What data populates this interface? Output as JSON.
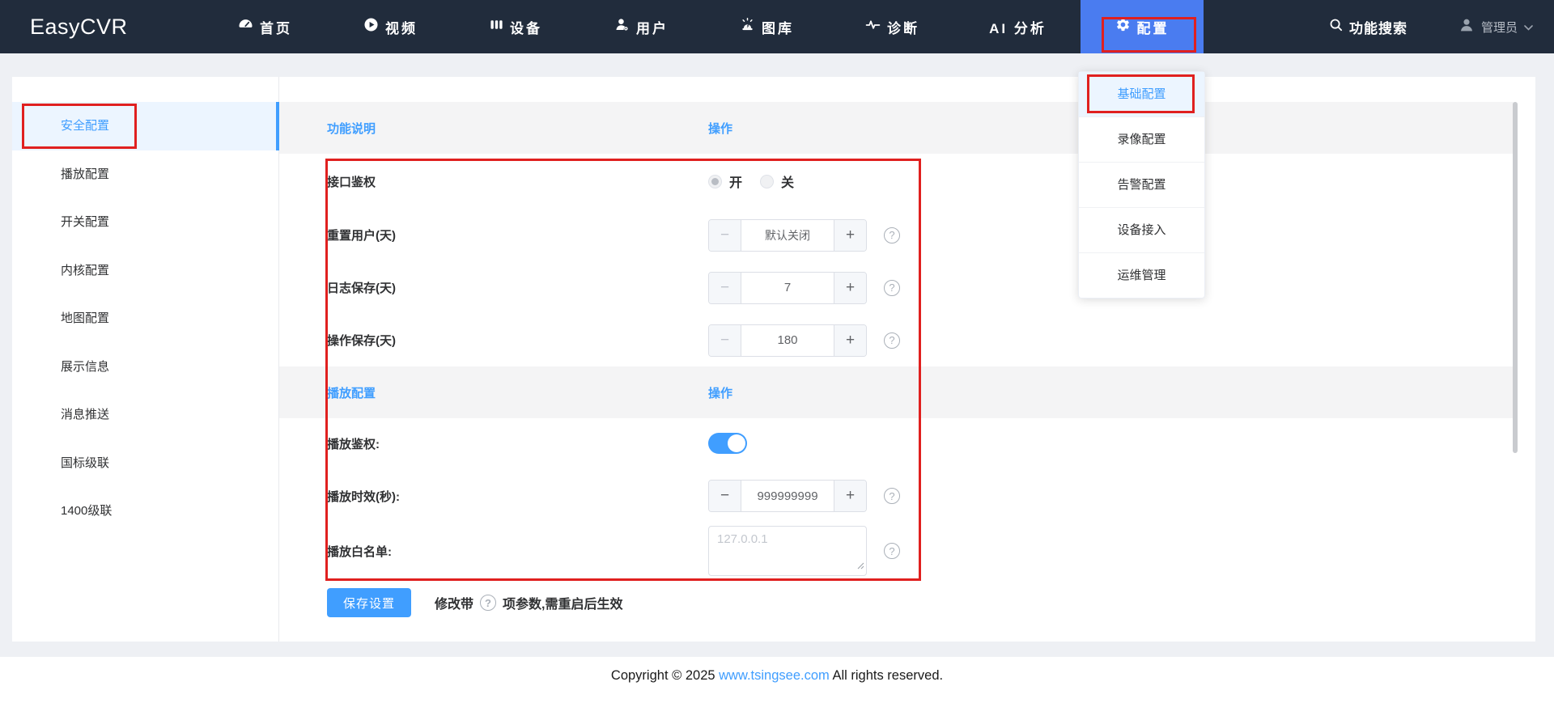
{
  "navbar": {
    "brand": "EasyCVR",
    "items": [
      {
        "label": "首页",
        "icon": "dashboard-icon"
      },
      {
        "label": "视频",
        "icon": "video-icon"
      },
      {
        "label": "设备",
        "icon": "device-icon"
      },
      {
        "label": "用户",
        "icon": "user-icon"
      },
      {
        "label": "图库",
        "icon": "gallery-icon"
      },
      {
        "label": "诊断",
        "icon": "diagnosis-icon"
      },
      {
        "label": "AI 分析",
        "icon": "none"
      },
      {
        "label": "配置",
        "icon": "gear-icon"
      }
    ],
    "search_label": "功能搜索",
    "user_label": "管理员"
  },
  "config_dropdown": {
    "items": [
      "基础配置",
      "录像配置",
      "告警配置",
      "设备接入",
      "运维管理"
    ],
    "active_item": "基础配置"
  },
  "sidebar": {
    "items": [
      "安全配置",
      "播放配置",
      "开关配置",
      "内核配置",
      "地图配置",
      "展示信息",
      "消息推送",
      "国标级联",
      "1400级联"
    ],
    "active_item": "安全配置"
  },
  "main": {
    "section1_header": {
      "left": "功能说明",
      "right": "操作"
    },
    "rows1": [
      {
        "label": "接口鉴权",
        "type": "radio",
        "options": [
          "开",
          "关"
        ],
        "selected": "开"
      },
      {
        "label": "重置用户(天)",
        "type": "stepper",
        "value": "默认关闭"
      },
      {
        "label": "日志保存(天)",
        "type": "stepper",
        "value": "7"
      },
      {
        "label": "操作保存(天)",
        "type": "stepper",
        "value": "180"
      }
    ],
    "section2_header": {
      "left": "播放配置",
      "right": "操作"
    },
    "rows2": [
      {
        "label": "播放鉴权:",
        "type": "switch",
        "state": "on"
      },
      {
        "label": "播放时效(秒):",
        "type": "stepper",
        "value": "999999999"
      },
      {
        "label": "播放白名单:",
        "type": "textarea",
        "placeholder": "127.0.0.1"
      }
    ],
    "save": {
      "button": "保存设置",
      "note_prefix": "修改带",
      "note_suffix": "项参数,需重启后生效"
    }
  },
  "ui": {
    "minus": "−",
    "plus": "+",
    "help": "?"
  },
  "footer": {
    "prefix": "Copyright © 2025 ",
    "link": "www.tsingsee.com",
    "suffix": " All rights reserved."
  },
  "colors": {
    "accent": "#409eff",
    "nav_active_bg": "#4a7cf0",
    "navbar_bg": "#212c3c",
    "annotation_red": "#e0201f",
    "active_item_bg": "#ecf5ff"
  }
}
